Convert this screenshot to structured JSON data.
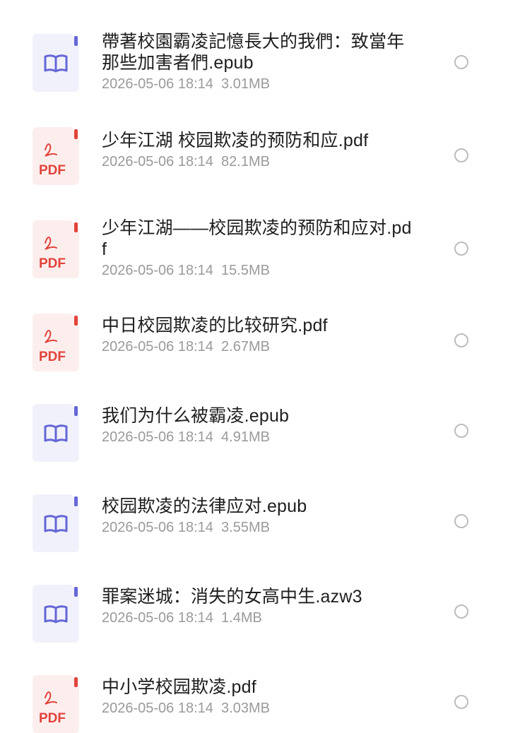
{
  "colors": {
    "epub_icon_bg": "#f1f1fb",
    "epub_icon_fg": "#6566d6",
    "pdf_icon_bg": "#fdeeee",
    "pdf_icon_fg": "#e2433a",
    "title_text": "#1e1e1e",
    "meta_text": "#9a9a9a",
    "radio_border": "#bdbdbd"
  },
  "files": [
    {
      "name": "帶著校園霸凌記憶長大的我們：致當年那些加害者們.epub",
      "date": "2026-05-06 18:14",
      "size": "3.01MB",
      "icon": "epub-book-icon",
      "type_label": ""
    },
    {
      "name": "少年江湖 校园欺凌的预防和应.pdf",
      "date": "2026-05-06 18:14",
      "size": "82.1MB",
      "icon": "pdf-icon",
      "type_label": "PDF"
    },
    {
      "name": "少年江湖——校园欺凌的预防和应对.pdf",
      "date": "2026-05-06 18:14",
      "size": "15.5MB",
      "icon": "pdf-icon",
      "type_label": "PDF"
    },
    {
      "name": "中日校园欺凌的比较研究.pdf",
      "date": "2026-05-06 18:14",
      "size": "2.67MB",
      "icon": "pdf-icon",
      "type_label": "PDF"
    },
    {
      "name": "我们为什么被霸凌.epub",
      "date": "2026-05-06 18:14",
      "size": "4.91MB",
      "icon": "epub-book-icon",
      "type_label": ""
    },
    {
      "name": "校园欺凌的法律应对.epub",
      "date": "2026-05-06 18:14",
      "size": "3.55MB",
      "icon": "epub-book-icon",
      "type_label": ""
    },
    {
      "name": "罪案迷城：消失的女高中生.azw3",
      "date": "2026-05-06 18:14",
      "size": "1.4MB",
      "icon": "epub-book-icon",
      "type_label": ""
    },
    {
      "name": "中小学校园欺凌.pdf",
      "date": "2026-05-06 18:14",
      "size": "3.03MB",
      "icon": "pdf-icon",
      "type_label": "PDF"
    }
  ]
}
